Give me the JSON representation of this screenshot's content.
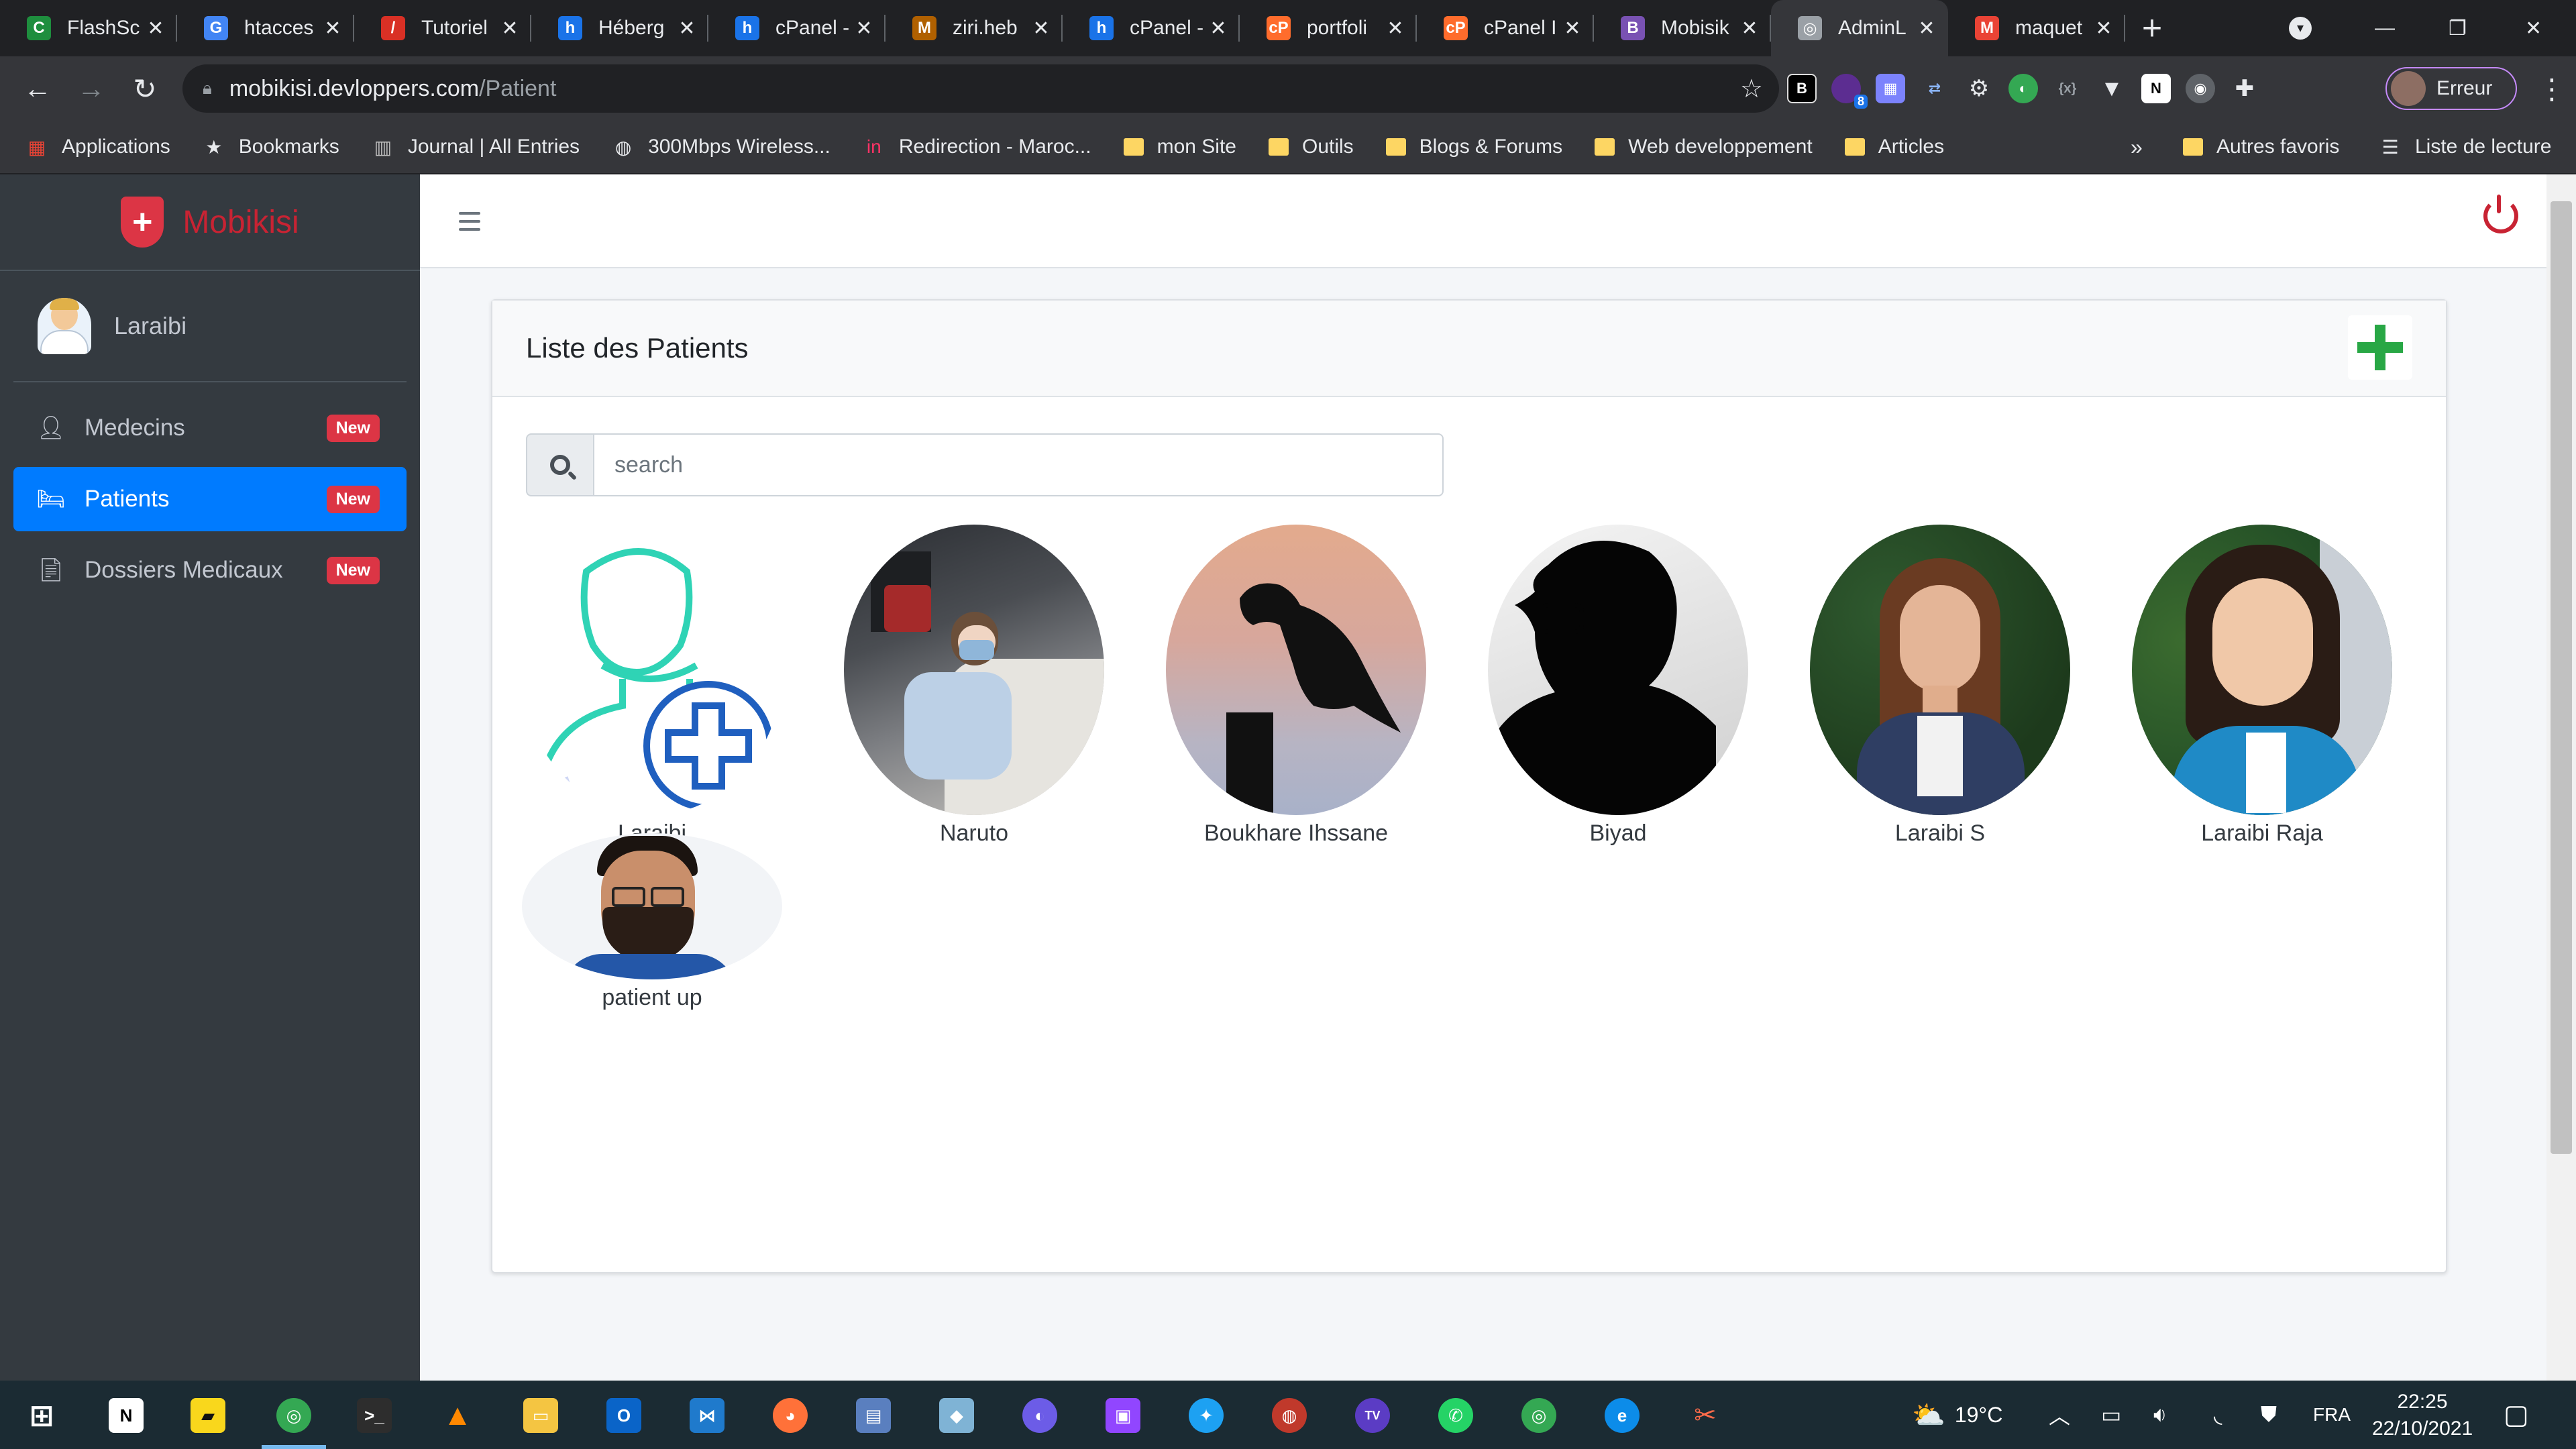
{
  "browser": {
    "tabs": [
      {
        "title": "FlashSc",
        "color": "#1e8e3e",
        "glyph": "C"
      },
      {
        "title": "htacces",
        "color": "#4285f4",
        "glyph": "G"
      },
      {
        "title": "Tutoriel",
        "color": "#d93025",
        "glyph": "/"
      },
      {
        "title": "Héberg",
        "color": "#1a73e8",
        "glyph": "h"
      },
      {
        "title": "cPanel -",
        "color": "#1a73e8",
        "glyph": "h"
      },
      {
        "title": "ziri.heb",
        "color": "#b06000",
        "glyph": "M"
      },
      {
        "title": "cPanel -",
        "color": "#1a73e8",
        "glyph": "h"
      },
      {
        "title": "portfoli",
        "color": "#ff6c2c",
        "glyph": "cP"
      },
      {
        "title": "cPanel I",
        "color": "#ff6c2c",
        "glyph": "cP"
      },
      {
        "title": "Mobisik",
        "color": "#7952b3",
        "glyph": "B"
      },
      {
        "title": "AdminL",
        "color": "#9aa0a6",
        "glyph": "◎"
      },
      {
        "title": "maquet",
        "color": "#ea4335",
        "glyph": "M"
      }
    ],
    "new_tab": "+",
    "url_host": "mobikisi.devloppers.com",
    "url_path": "/Patient",
    "profile_label": "Erreur",
    "bookmarks": [
      {
        "label": "Applications",
        "icon": "apps-grid-icon"
      },
      {
        "label": "Bookmarks",
        "icon": "star-icon"
      },
      {
        "label": "Journal | All Entries",
        "icon": "journal-icon"
      },
      {
        "label": "300Mbps Wireless...",
        "icon": "globe-icon"
      },
      {
        "label": "Redirection - Maroc...",
        "icon": "invision-icon"
      },
      {
        "label": "mon Site",
        "icon": "folder-icon"
      },
      {
        "label": "Outils",
        "icon": "folder-icon"
      },
      {
        "label": "Blogs & Forums",
        "icon": "folder-icon"
      },
      {
        "label": "Web developpement",
        "icon": "folder-icon"
      },
      {
        "label": "Articles",
        "icon": "folder-icon"
      }
    ],
    "bookmarks_overflow": "»",
    "other_bookmarks": "Autres favoris",
    "reading_list": "Liste de lecture",
    "extension_badge": "8"
  },
  "sidebar": {
    "brand": "Mobikisi",
    "user_name": "Laraibi",
    "items": [
      {
        "label": "Medecins",
        "badge": "New",
        "icon": "user-md-icon",
        "active": false
      },
      {
        "label": "Patients",
        "badge": "New",
        "icon": "bed-icon",
        "active": true
      },
      {
        "label": "Dossiers Medicaux",
        "badge": "New",
        "icon": "medical-file-icon",
        "active": false
      }
    ]
  },
  "main": {
    "card_title": "Liste des Patients",
    "search_placeholder": "search",
    "patients": [
      {
        "name": "Laraibi",
        "photo": "placeholder-add-patient"
      },
      {
        "name": "Naruto",
        "photo": "hospital-bed"
      },
      {
        "name": "Boukhare Ihssane",
        "photo": "eagle-silhouette"
      },
      {
        "name": "Biyad",
        "photo": "person-silhouette"
      },
      {
        "name": "Laraibi S",
        "photo": "woman-portrait"
      },
      {
        "name": "Laraibi Raja",
        "photo": "woman-portrait-scarf"
      },
      {
        "name": "patient up",
        "photo": "man-portrait"
      }
    ]
  },
  "taskbar": {
    "weather": "19°C",
    "language": "FRA",
    "time": "22:25",
    "date": "22/10/2021"
  },
  "colors": {
    "sidebar_bg": "#343a40",
    "active_blue": "#007bff",
    "badge_red": "#dc3545",
    "brand_red": "#c82333",
    "add_green": "#28a745"
  }
}
